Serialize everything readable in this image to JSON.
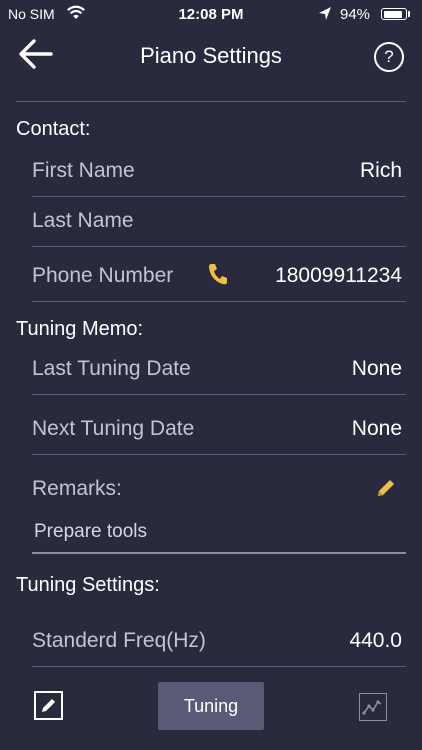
{
  "colors": {
    "background": "#2a2a3e",
    "divider": "#5c5c72",
    "accent_icon": "#f0c040",
    "tuning_button": "#5a5a76"
  },
  "status_bar": {
    "carrier": "No SIM",
    "time": "12:08 PM",
    "battery_text": "94%",
    "battery_level": 0.94
  },
  "header": {
    "title": "Piano Settings",
    "help_label": "?"
  },
  "contact": {
    "section_title": "Contact:",
    "first_name_label": "First Name",
    "first_name_value": "Rich",
    "last_name_label": "Last Name",
    "last_name_value": "",
    "phone_label": "Phone Number",
    "phone_value": "18009911234"
  },
  "tuning_memo": {
    "section_title": "Tuning Memo:",
    "last_tuning_label": "Last Tuning Date",
    "last_tuning_value": "None",
    "next_tuning_label": "Next Tuning Date",
    "next_tuning_value": "None",
    "remarks_label": "Remarks:",
    "remarks_value": "Prepare tools"
  },
  "tuning_settings": {
    "section_title": "Tuning Settings:",
    "freq_label": "Standerd Freq(Hz)",
    "freq_value": "440.0"
  },
  "bottom_bar": {
    "tuning_label": "Tuning"
  }
}
